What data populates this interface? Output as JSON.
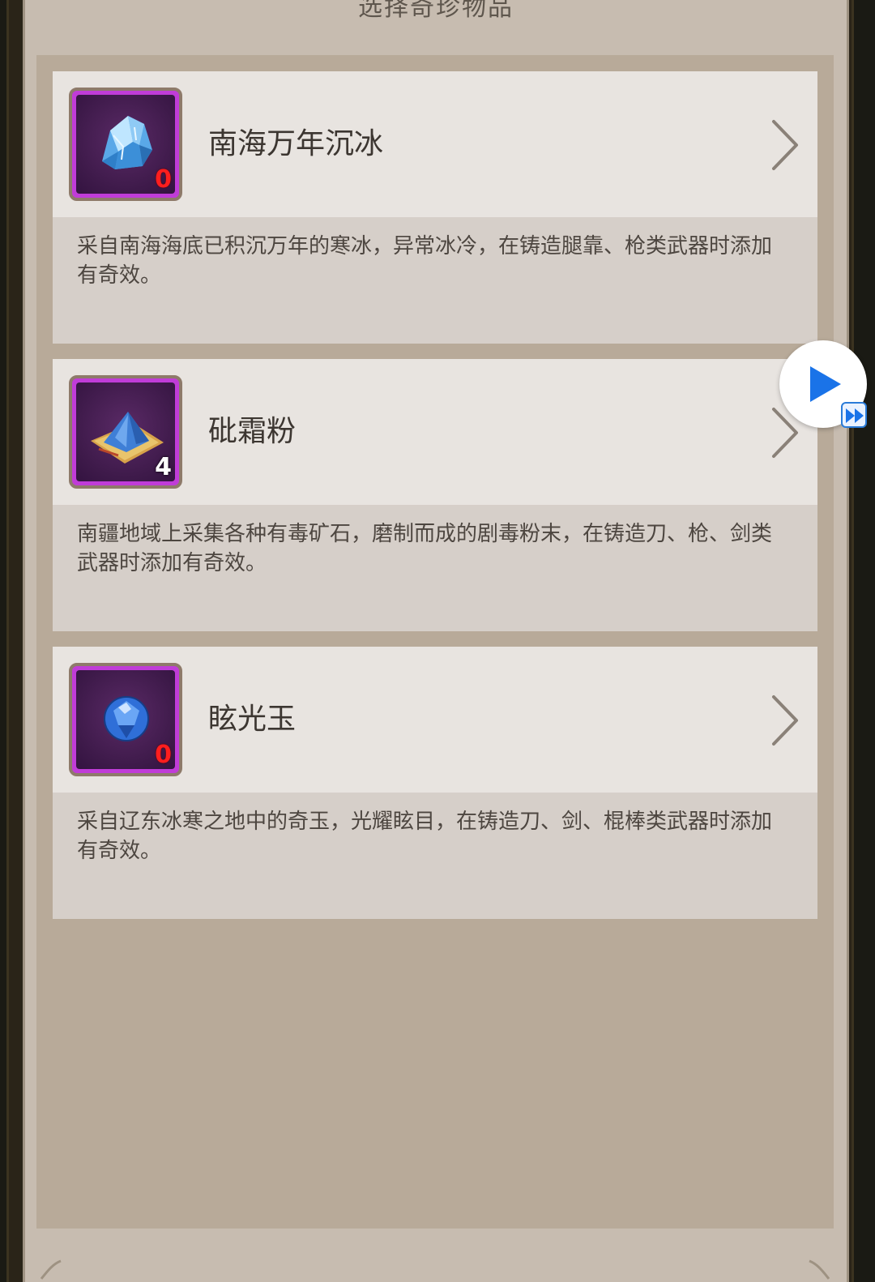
{
  "header": {
    "title": "选择奇珍物品"
  },
  "items": [
    {
      "name": "南海万年沉冰",
      "count": "0",
      "description": "采自南海海底已积沉万年的寒冰，异常冰冷，在铸造腿靠、枪类武器时添加有奇效。",
      "icon": "blue-ice-icon"
    },
    {
      "name": "砒霜粉",
      "count": "4",
      "description": "南疆地域上采集各种有毒矿石，磨制而成的剧毒粉末，在铸造刀、枪、剑类武器时添加有奇效。",
      "icon": "blue-powder-icon"
    },
    {
      "name": "眩光玉",
      "count": "0",
      "description": "采自辽东冰寒之地中的奇玉，光耀眩目，在铸造刀、剑、棍棒类武器时添加有奇效。",
      "icon": "blue-gem-icon"
    }
  ],
  "colors": {
    "icon_frame": "#c03cd8",
    "count_zero": "#ff1e1e",
    "play_accent": "#1a73e8"
  }
}
